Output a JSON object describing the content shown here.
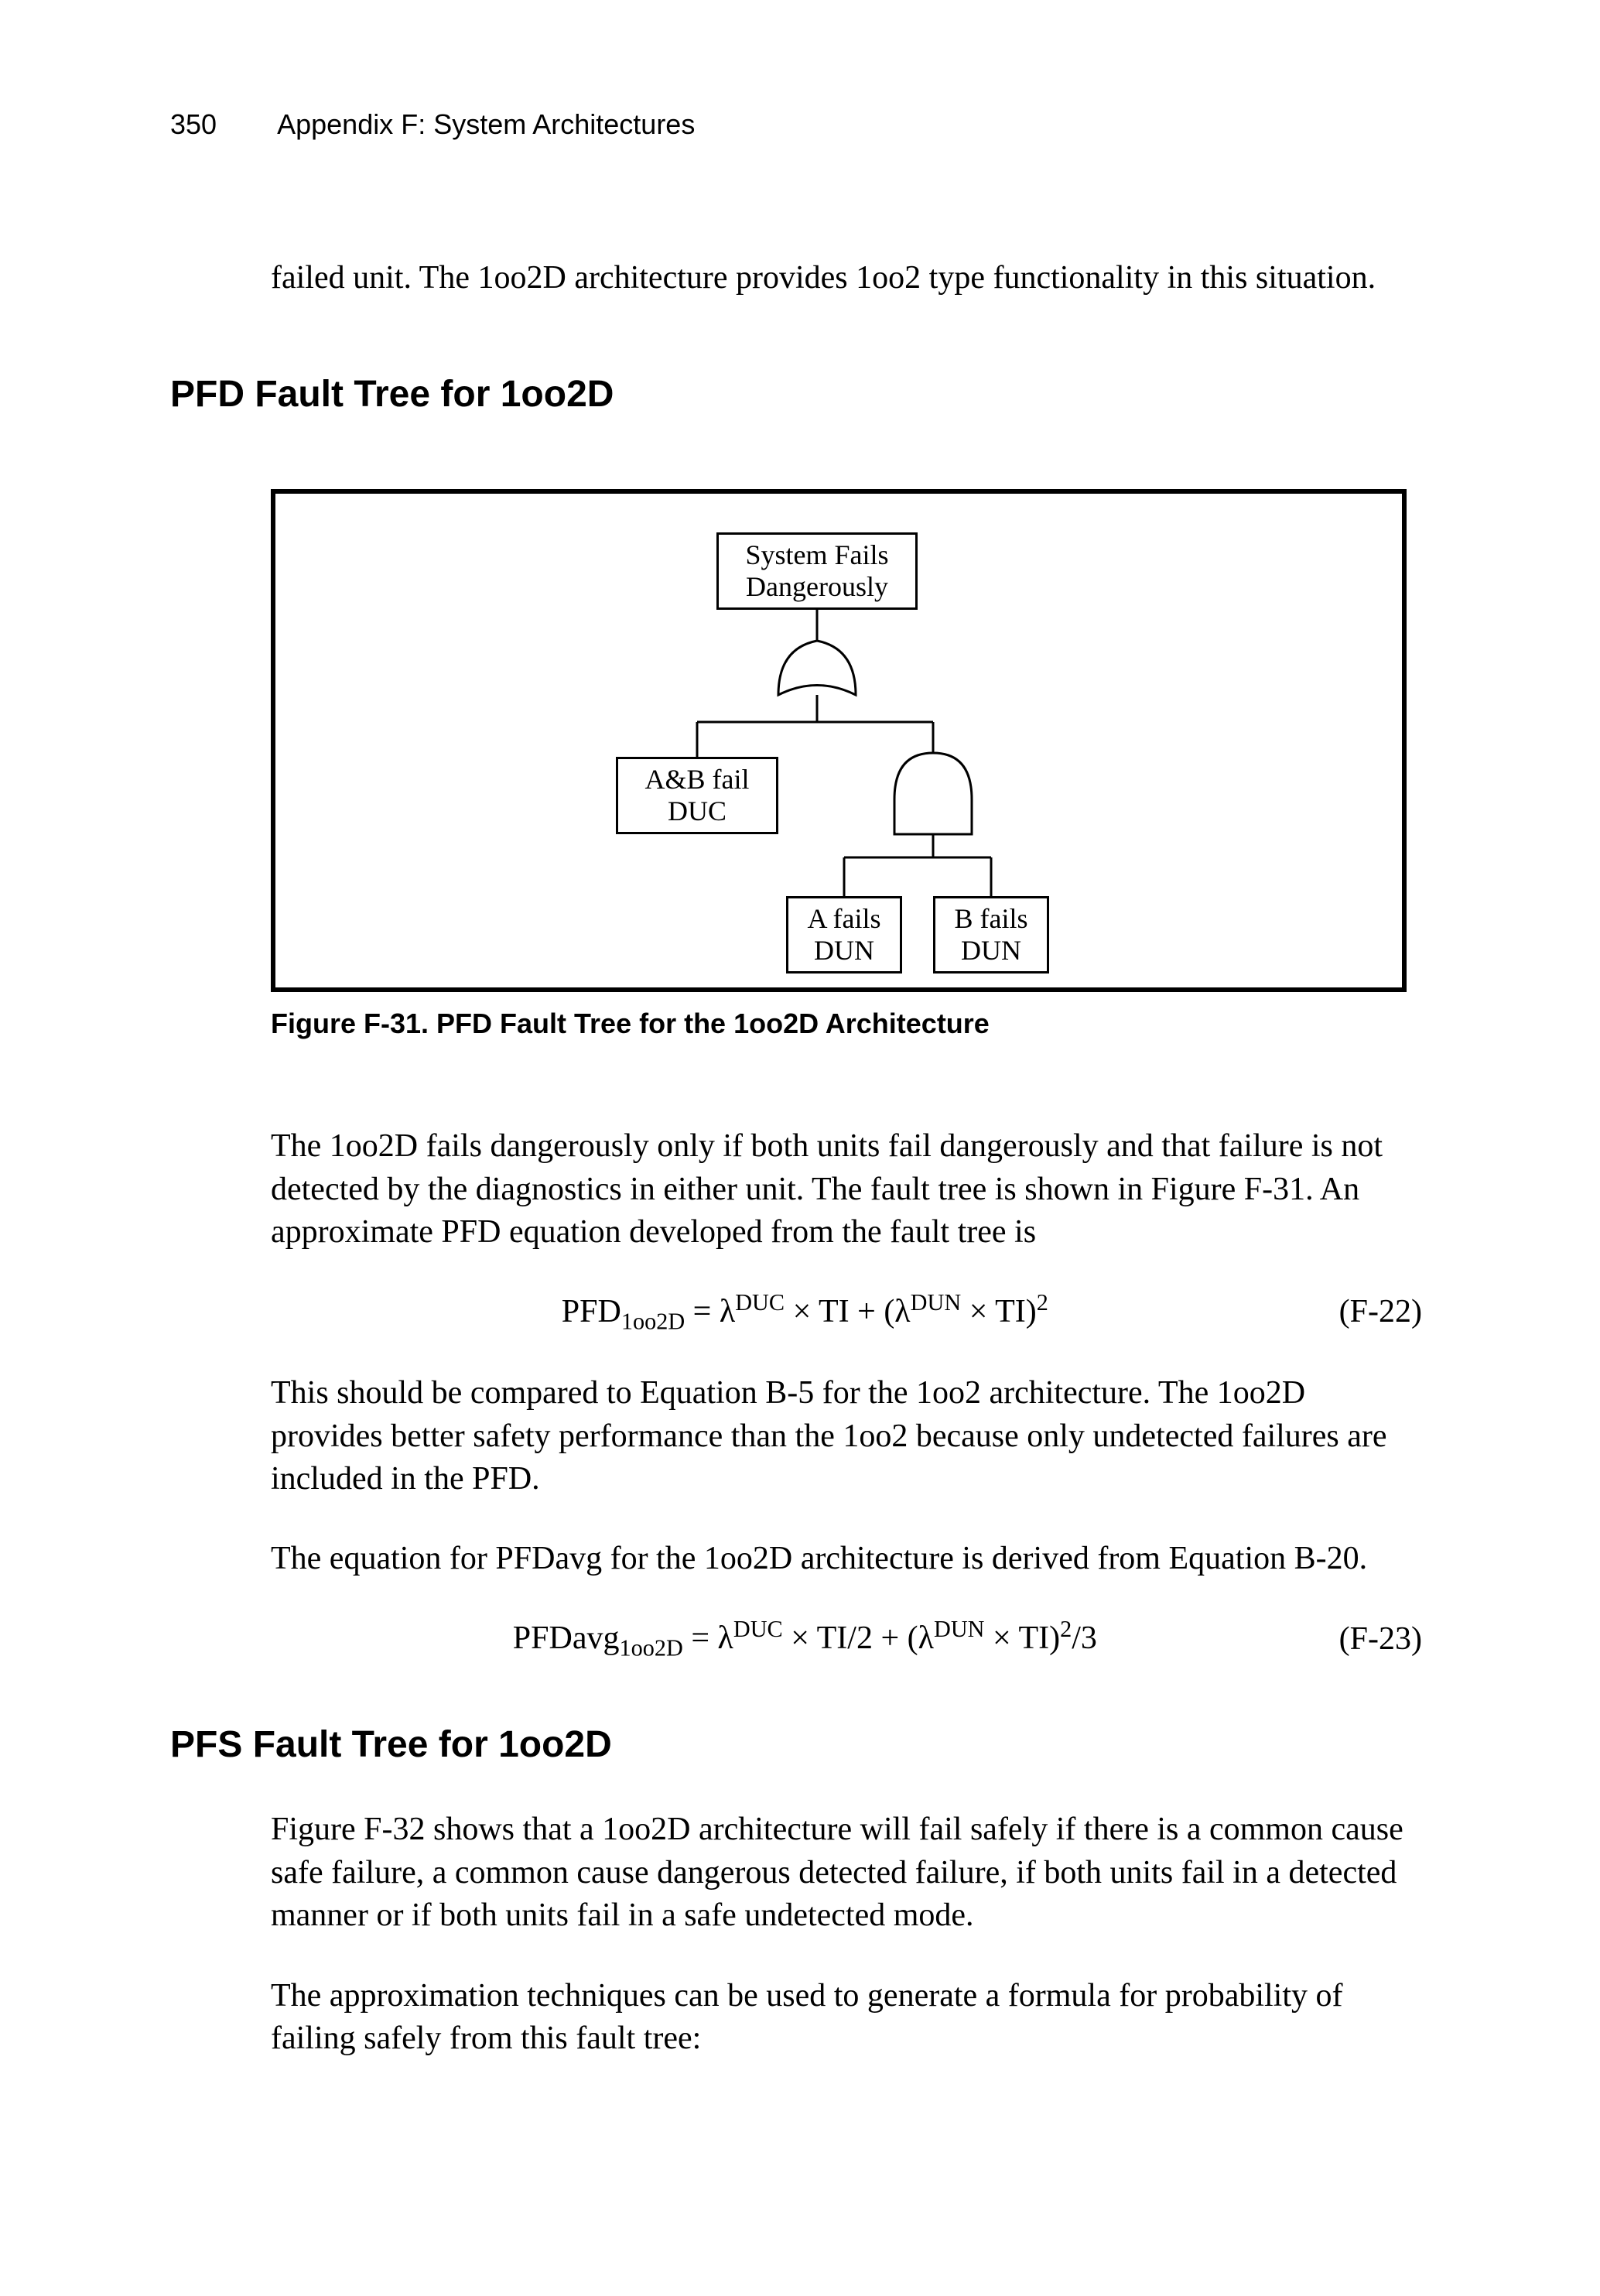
{
  "header": {
    "page_number": "350",
    "appendix": "Appendix F: System Architectures"
  },
  "p_intro": "failed unit. The 1oo2D architecture provides 1oo2 type functionality in this situation.",
  "sec1_heading": "PFD Fault Tree for 1oo2D",
  "fault_tree": {
    "top": "System Fails\nDangerously",
    "left": "A&B fail\nDUC",
    "a": "A fails\nDUN",
    "b": "B fails\nDUN"
  },
  "fig_caption": "Figure F-31. PFD Fault Tree for the 1oo2D Architecture",
  "p_after_fig": "The 1oo2D fails dangerously only if both units fail dangerously and that failure is not detected by the diagnostics in either unit. The fault tree is shown in Figure F-31. An approximate PFD equation developed from the fault tree is",
  "eq_f22": {
    "lhs_base": "PFD",
    "lhs_sub": "1oo2D",
    "term1_sup": "DUC",
    "mid_text": " × TI + (λ",
    "term2_sup": "DUN",
    "tail_text": " × TI)",
    "tail_sup": "2",
    "number": "(F-22)"
  },
  "p_compare": "This should be compared to Equation B-5 for the 1oo2 architecture. The 1oo2D provides better safety performance than the 1oo2 because only undetected failures are included in the PFD.",
  "p_pfdavg_intro": "The equation for PFDavg for the 1oo2D architecture is derived from Equation B-20.",
  "eq_f23": {
    "lhs_base": "PFDavg",
    "lhs_sub": "1oo2D",
    "term1_sup": "DUC",
    "mid_text": " × TI/2 + (λ",
    "term2_sup": "DUN",
    "tail_text": " × TI)",
    "tail_sup": "2",
    "tail_extra": "/3",
    "number": "(F-23)"
  },
  "sec2_heading": "PFS Fault Tree for 1oo2D",
  "p_pfs1": "Figure F-32 shows that a 1oo2D architecture will fail safely if there is a common cause safe failure, a common cause dangerous detected failure, if both units fail in a detected manner or if both units fail in a safe undetected mode.",
  "p_pfs2": "The approximation techniques can be used to generate a formula for probability of failing safely from this fault tree:"
}
